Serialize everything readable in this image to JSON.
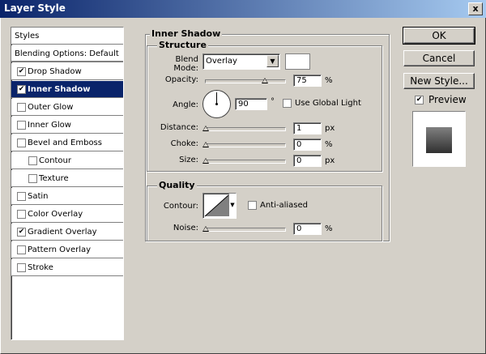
{
  "window": {
    "title": "Layer Style",
    "close": "x"
  },
  "sidebar": {
    "items": [
      {
        "label": "Styles",
        "checkbox": false,
        "checked": false,
        "selected": false,
        "indent": 0
      },
      {
        "label": "Blending Options: Default",
        "checkbox": false,
        "checked": false,
        "selected": false,
        "indent": 0
      },
      {
        "label": "Drop Shadow",
        "checkbox": true,
        "checked": true,
        "selected": false,
        "indent": 0
      },
      {
        "label": "Inner Shadow",
        "checkbox": true,
        "checked": true,
        "selected": true,
        "indent": 0
      },
      {
        "label": "Outer Glow",
        "checkbox": true,
        "checked": false,
        "selected": false,
        "indent": 0
      },
      {
        "label": "Inner Glow",
        "checkbox": true,
        "checked": false,
        "selected": false,
        "indent": 0
      },
      {
        "label": "Bevel and Emboss",
        "checkbox": true,
        "checked": false,
        "selected": false,
        "indent": 0
      },
      {
        "label": "Contour",
        "checkbox": true,
        "checked": false,
        "selected": false,
        "indent": 1
      },
      {
        "label": "Texture",
        "checkbox": true,
        "checked": false,
        "selected": false,
        "indent": 1
      },
      {
        "label": "Satin",
        "checkbox": true,
        "checked": false,
        "selected": false,
        "indent": 0
      },
      {
        "label": "Color Overlay",
        "checkbox": true,
        "checked": false,
        "selected": false,
        "indent": 0
      },
      {
        "label": "Gradient Overlay",
        "checkbox": true,
        "checked": true,
        "selected": false,
        "indent": 0
      },
      {
        "label": "Pattern Overlay",
        "checkbox": true,
        "checked": false,
        "selected": false,
        "indent": 0
      },
      {
        "label": "Stroke",
        "checkbox": true,
        "checked": false,
        "selected": false,
        "indent": 0
      }
    ]
  },
  "panel": {
    "title": "Inner Shadow",
    "structure": {
      "title": "Structure",
      "blend_mode_label": "Blend Mode:",
      "blend_mode_value": "Overlay",
      "opacity_label": "Opacity:",
      "opacity_value": "75",
      "opacity_unit": "%",
      "opacity_level": 0.75,
      "angle_label": "Angle:",
      "angle_value": "90",
      "angle_unit": "°",
      "use_global_light_label": "Use Global Light",
      "use_global_light_checked": false,
      "distance_label": "Distance:",
      "distance_value": "1",
      "distance_unit": "px",
      "choke_label": "Choke:",
      "choke_value": "0",
      "choke_unit": "%",
      "size_label": "Size:",
      "size_value": "0",
      "size_unit": "px"
    },
    "quality": {
      "title": "Quality",
      "contour_label": "Contour:",
      "anti_aliased_label": "Anti-aliased",
      "anti_aliased_checked": false,
      "noise_label": "Noise:",
      "noise_value": "0",
      "noise_unit": "%"
    }
  },
  "buttons": {
    "ok": "OK",
    "cancel": "Cancel",
    "new_style": "New Style..."
  },
  "preview": {
    "label": "Preview",
    "checked": true
  },
  "colors": {
    "titlebar_start": "#0a246a",
    "titlebar_end": "#a6caf0",
    "selection": "#0a246a",
    "dialog_bg": "#d4d0c8"
  }
}
